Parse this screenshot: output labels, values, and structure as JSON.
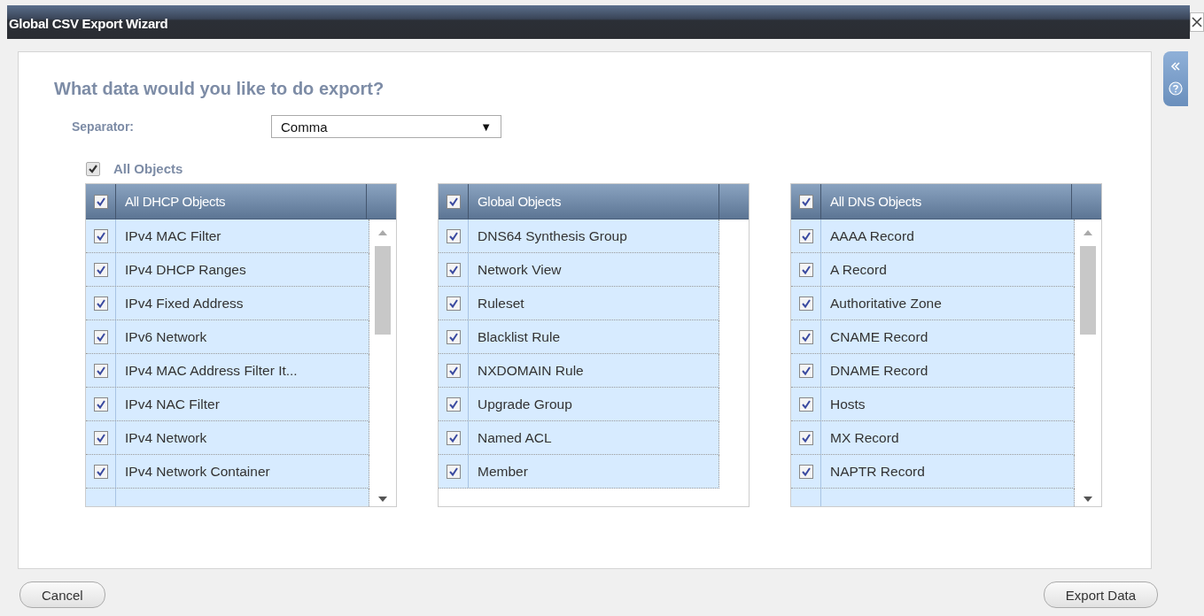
{
  "window": {
    "title": "Global CSV Export Wizard"
  },
  "heading": "What data would you like to do export?",
  "separator": {
    "label": "Separator:",
    "value": "Comma",
    "arrow": "▼"
  },
  "all_objects": {
    "label": "All Objects",
    "checked": true
  },
  "lists": [
    {
      "header": "All DHCP Objects",
      "checked": true,
      "scrollable": true,
      "items": [
        {
          "label": "IPv4 MAC Filter",
          "checked": true
        },
        {
          "label": "IPv4 DHCP Ranges",
          "checked": true
        },
        {
          "label": "IPv4 Fixed Address",
          "checked": true
        },
        {
          "label": "IPv6 Network",
          "checked": true
        },
        {
          "label": "IPv4 MAC Address Filter It...",
          "checked": true
        },
        {
          "label": "IPv4 NAC Filter",
          "checked": true
        },
        {
          "label": "IPv4 Network",
          "checked": true
        },
        {
          "label": "IPv4 Network Container",
          "checked": true
        }
      ]
    },
    {
      "header": "Global Objects",
      "checked": true,
      "scrollable": false,
      "items": [
        {
          "label": "DNS64 Synthesis Group",
          "checked": true
        },
        {
          "label": "Network View",
          "checked": true
        },
        {
          "label": "Ruleset",
          "checked": true
        },
        {
          "label": "Blacklist Rule",
          "checked": true
        },
        {
          "label": "NXDOMAIN Rule",
          "checked": true
        },
        {
          "label": "Upgrade Group",
          "checked": true
        },
        {
          "label": "Named ACL",
          "checked": true
        },
        {
          "label": "Member",
          "checked": true
        }
      ]
    },
    {
      "header": "All DNS Objects",
      "checked": true,
      "scrollable": true,
      "items": [
        {
          "label": "AAAA Record",
          "checked": true
        },
        {
          "label": "A Record",
          "checked": true
        },
        {
          "label": "Authoritative Zone",
          "checked": true
        },
        {
          "label": "CNAME Record",
          "checked": true
        },
        {
          "label": "DNAME Record",
          "checked": true
        },
        {
          "label": "Hosts",
          "checked": true
        },
        {
          "label": "MX Record",
          "checked": true
        },
        {
          "label": "NAPTR Record",
          "checked": true
        }
      ]
    }
  ],
  "buttons": {
    "cancel": "Cancel",
    "export": "Export Data"
  }
}
